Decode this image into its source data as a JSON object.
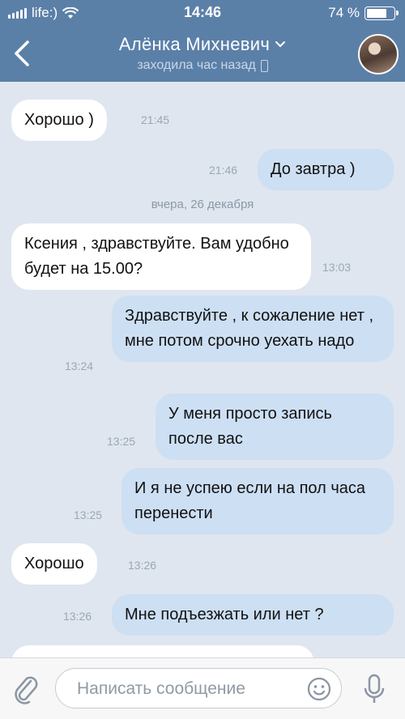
{
  "status_bar": {
    "carrier": "life:)",
    "time": "14:46",
    "battery_text": "74 %",
    "battery_level": 0.74
  },
  "header": {
    "contact_name": "Алёнка Михневич",
    "last_seen": "заходила час назад"
  },
  "chat": {
    "messages": [
      {
        "text": "Хорошо )",
        "time": "21:45",
        "side": "in"
      },
      {
        "text": "До завтра )",
        "time": "21:46",
        "side": "out"
      },
      {
        "text": "Ксения , здравствуйте.  Вам удобно будет на 15.00?",
        "time": "13:03",
        "side": "in"
      },
      {
        "text": "Здравствуйте , к сожаление нет , мне потом срочно уехать надо",
        "time": "13:24",
        "side": "out"
      },
      {
        "text": "У меня просто запись после вас",
        "time": "13:25",
        "side": "out"
      },
      {
        "text": "И я не успею если на пол часа перенести",
        "time": "13:25",
        "side": "out"
      },
      {
        "text": "Хорошо",
        "time": "13:26",
        "side": "in"
      },
      {
        "text": "Мне подъезжать или нет ?",
        "time": "13:26",
        "side": "out"
      }
    ],
    "date_separator": "вчера, 26 декабря"
  },
  "composer": {
    "placeholder": "Написать сообщение"
  },
  "colors": {
    "header_bg": "#5b80a8",
    "chat_bg": "#dfe6ef",
    "outgoing_bubble": "#cddff3",
    "incoming_bubble": "#ffffff"
  },
  "icons": [
    "signal-icon",
    "wifi-icon",
    "battery-icon",
    "back-arrow-icon",
    "chevron-down-icon",
    "phone-icon",
    "paperclip-icon",
    "emoji-icon",
    "microphone-icon"
  ]
}
